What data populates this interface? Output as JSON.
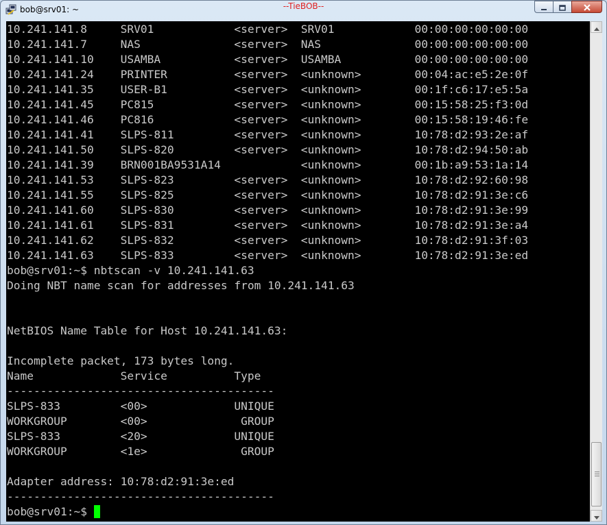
{
  "window": {
    "title": "bob@srv01: ~",
    "center_label": "--TieBOB--",
    "app_icon": "putty-icon",
    "controls": [
      "minimize-icon",
      "maximize-icon",
      "close-icon"
    ]
  },
  "terminal": {
    "cursor_color": "#00ff00",
    "text_color": "#c9c9c9",
    "background": "#000000",
    "lines": [
      "10.241.141.8     SRV01            <server>  SRV01            00:00:00:00:00:00",
      "10.241.141.7     NAS              <server>  NAS              00:00:00:00:00:00",
      "10.241.141.10    USAMBA           <server>  USAMBA           00:00:00:00:00:00",
      "10.241.141.24    PRINTER          <server>  <unknown>        00:04:ac:e5:2e:0f",
      "10.241.141.35    USER-B1          <server>  <unknown>        00:1f:c6:17:e5:5a",
      "10.241.141.45    PC815            <server>  <unknown>        00:15:58:25:f3:0d",
      "10.241.141.46    PC816            <server>  <unknown>        00:15:58:19:46:fe",
      "10.241.141.41    SLPS-811         <server>  <unknown>        10:78:d2:93:2e:af",
      "10.241.141.50    SLPS-820         <server>  <unknown>        10:78:d2:94:50:ab",
      "10.241.141.39    BRN001BA9531A14            <unknown>        00:1b:a9:53:1a:14",
      "10.241.141.53    SLPS-823         <server>  <unknown>        10:78:d2:92:60:98",
      "10.241.141.55    SLPS-825         <server>  <unknown>        10:78:d2:91:3e:c6",
      "10.241.141.60    SLPS-830         <server>  <unknown>        10:78:d2:91:3e:99",
      "10.241.141.61    SLPS-831         <server>  <unknown>        10:78:d2:91:3e:a4",
      "10.241.141.62    SLPS-832         <server>  <unknown>        10:78:d2:91:3f:03",
      "10.241.141.63    SLPS-833         <server>  <unknown>        10:78:d2:91:3e:ed",
      "bob@srv01:~$ nbtscan -v 10.241.141.63",
      "Doing NBT name scan for addresses from 10.241.141.63",
      "",
      "",
      "NetBIOS Name Table for Host 10.241.141.63:",
      "",
      "Incomplete packet, 173 bytes long.",
      "Name             Service          Type",
      "----------------------------------------",
      "SLPS-833         <00>             UNIQUE",
      "WORKGROUP        <00>              GROUP",
      "SLPS-833         <20>             UNIQUE",
      "WORKGROUP        <1e>              GROUP",
      "",
      "Adapter address: 10:78:d2:91:3e:ed",
      "----------------------------------------"
    ],
    "prompt": "bob@srv01:~$ "
  },
  "scrollbar": {
    "up_icon": "arrow-up-icon",
    "down_icon": "arrow-down-icon",
    "position": 0.97
  }
}
